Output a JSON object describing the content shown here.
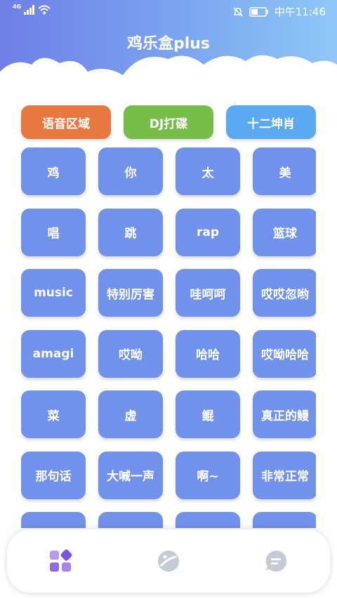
{
  "status_bar": {
    "network": "4G",
    "time": "中午11:46"
  },
  "app": {
    "title": "鸡乐盒plus"
  },
  "categories": [
    {
      "label": "语音区域",
      "color": "#e7783f"
    },
    {
      "label": "DJ打碟",
      "color": "#76bd4a"
    },
    {
      "label": "十二坤肖",
      "color": "#5aa9f1"
    }
  ],
  "sound_buttons": [
    "鸡",
    "你",
    "太",
    "美",
    "唱",
    "跳",
    "rap",
    "篮球",
    "music",
    "特别厉害",
    "哇呵呵",
    "哎哎忽哟",
    "amagi",
    "哎呦",
    "哈哈",
    "哎呦哈哈",
    "菜",
    "虚",
    "鲲",
    "真正的鳗",
    "那句话",
    "大喊一声",
    "啊~",
    "非常正常",
    "",
    "",
    "",
    ""
  ],
  "bottom_nav": [
    {
      "name": "home",
      "icon": "grid-apps-icon",
      "color": "#8f6be8"
    },
    {
      "name": "discover",
      "icon": "planet-icon",
      "color": "#c5cbd6"
    },
    {
      "name": "messages",
      "icon": "chat-bubble-icon",
      "color": "#c5cbd6"
    }
  ]
}
